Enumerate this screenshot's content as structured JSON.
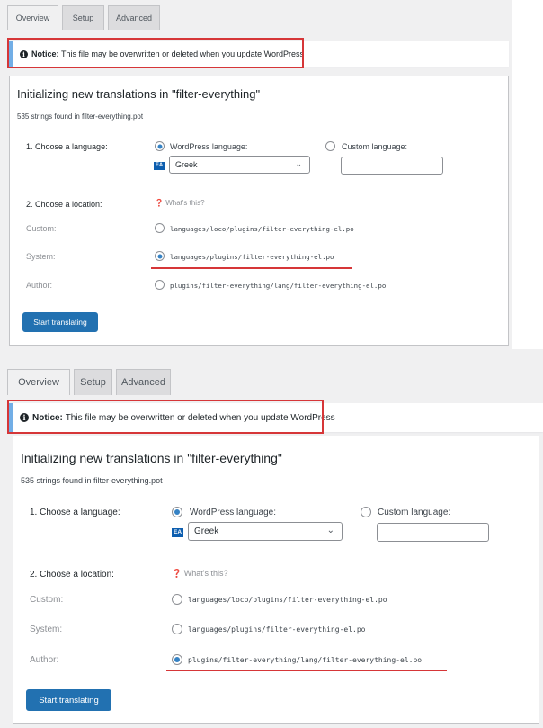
{
  "tabs": [
    "Overview",
    "Setup",
    "Advanced"
  ],
  "notice": {
    "label": "Notice:",
    "text": "This file may be overwritten or deleted when you update WordPress"
  },
  "card": {
    "title": "Initializing new translations in \"filter-everything\"",
    "strings_found": "535 strings found in filter-everything.pot",
    "language_label": "1. Choose a language:",
    "wp_language": "WordPress language:",
    "custom_language": "Custom language:",
    "flag": "EA",
    "selected_language": "Greek",
    "location_label": "2. Choose a location:",
    "whats_this": "What's this?",
    "custom_label": "Custom:",
    "system_label": "System:",
    "author_label": "Author:",
    "custom_path": "languages/loco/plugins/filter-everything-el.po",
    "system_path": "languages/plugins/filter-everything-el.po",
    "author_path": "plugins/filter-everything/lang/filter-everything-el.po",
    "start_button": "Start translating"
  },
  "screens": [
    {
      "selected_location": "system"
    },
    {
      "selected_location": "author"
    }
  ]
}
